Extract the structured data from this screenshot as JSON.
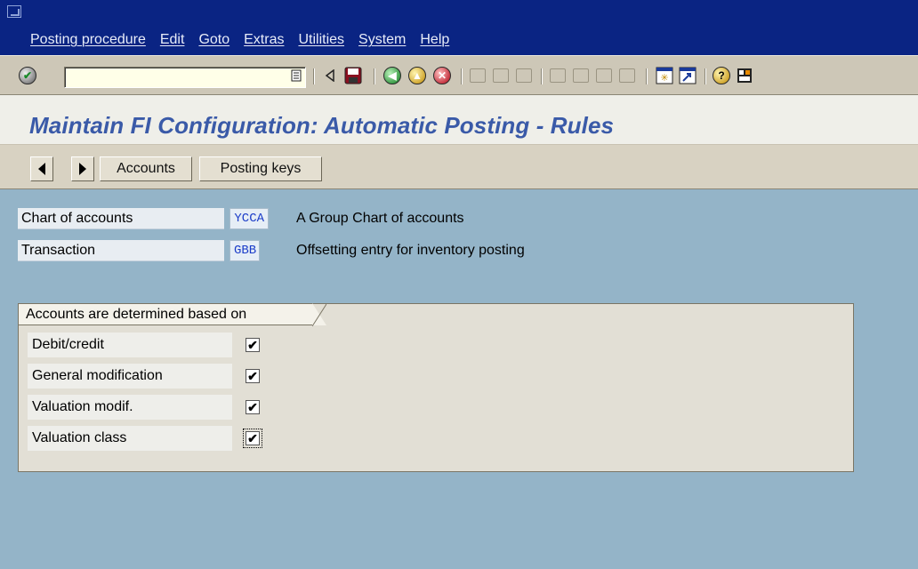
{
  "menu": {
    "items": [
      "Posting procedure",
      "Edit",
      "Goto",
      "Extras",
      "Utilities",
      "System",
      "Help"
    ]
  },
  "toolbar": {
    "command_field_value": "",
    "icons": [
      "enter-icon",
      "command-history-icon",
      "back-arrow-icon",
      "save-icon",
      "back-icon",
      "exit-icon",
      "cancel-icon",
      "print-icon",
      "find-icon",
      "find-next-icon",
      "first-page-icon",
      "previous-page-icon",
      "next-page-icon",
      "last-page-icon",
      "create-session-icon",
      "create-shortcut-icon",
      "help-icon",
      "layout-menu-icon"
    ]
  },
  "title": "Maintain FI Configuration: Automatic Posting - Rules",
  "app_toolbar": {
    "accounts_label": "Accounts",
    "posting_keys_label": "Posting keys"
  },
  "header": {
    "chart_of_accounts": {
      "label": "Chart of accounts",
      "value": "YCCA",
      "description": "A Group Chart of accounts"
    },
    "transaction": {
      "label": "Transaction",
      "value": "GBB",
      "description": "Offsetting entry for inventory posting"
    }
  },
  "group": {
    "title": "Accounts are determined based on",
    "options": [
      {
        "label": "Debit/credit",
        "checked": true
      },
      {
        "label": "General modification",
        "checked": true
      },
      {
        "label": "Valuation modif.",
        "checked": true
      },
      {
        "label": "Valuation class",
        "checked": true
      }
    ]
  },
  "colors": {
    "menubar": "#0a2483",
    "title_text": "#3a5aa8",
    "workarea": "#94b4c8",
    "value_text": "#1b3cc8"
  }
}
